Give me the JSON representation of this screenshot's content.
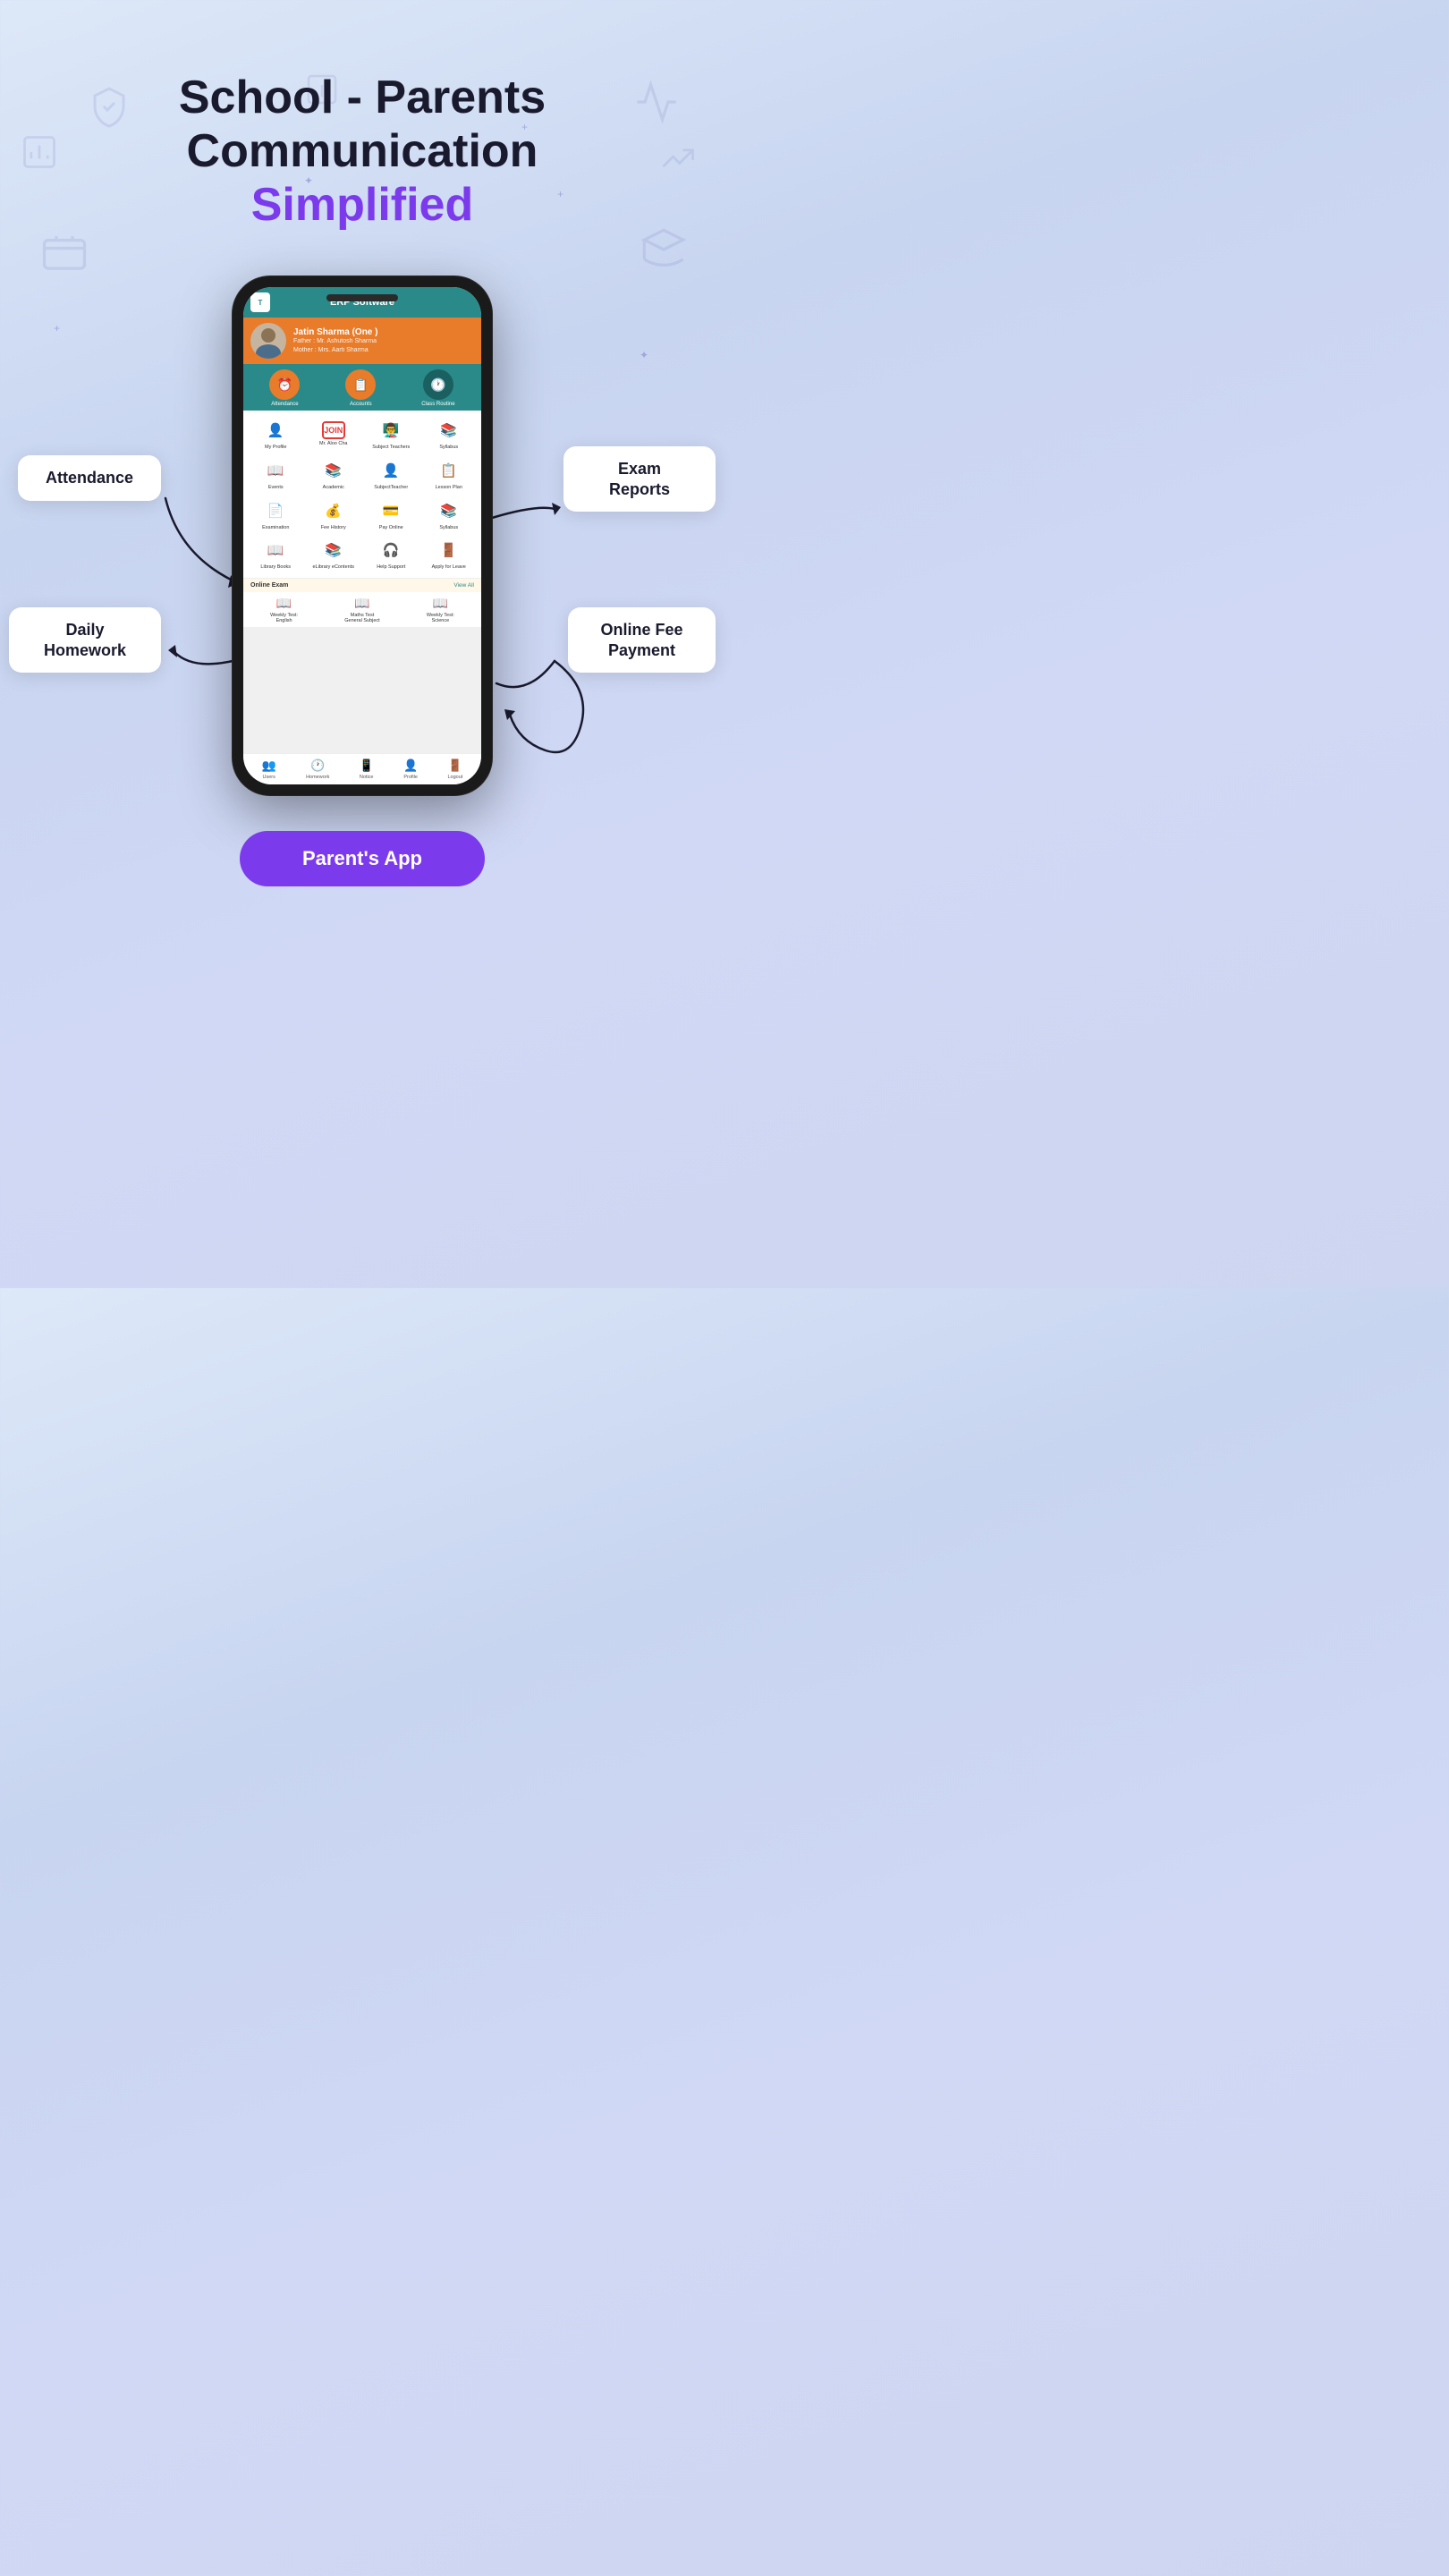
{
  "page": {
    "background": "linear-gradient(160deg, #dde8f8 0%, #c8d5f0 30%, #d0d8f5 60%, #cdd5f0 100%)"
  },
  "header": {
    "line1": "School - Parents",
    "line2": "Communication",
    "line3": "Simplified"
  },
  "app": {
    "title": "ERP Software",
    "logo_text": "T",
    "student": {
      "name": "Jatin Sharma (One )",
      "father": "Father : Mr. Ashutosh Sharma",
      "mother": "Mother : Mrs. Aarti Sharma"
    },
    "quick_nav": [
      {
        "label": "Attendance",
        "icon": "⏰"
      },
      {
        "label": "Accounts",
        "icon": "📋"
      },
      {
        "label": "Class Routine",
        "icon": "🕐"
      }
    ],
    "grid_items": [
      {
        "label": "My Profile",
        "icon": "👤",
        "color": "#e53935"
      },
      {
        "label": "Mr. Aloo Cha",
        "icon": "JOIN",
        "color": "#e53935"
      },
      {
        "label": "Subject Teachers",
        "icon": "👨‍🏫",
        "color": "#1565c0"
      },
      {
        "label": "Syllabus",
        "icon": "📚",
        "color": "#e87c2a"
      },
      {
        "label": "Events",
        "icon": "📖",
        "color": "#1565c0"
      },
      {
        "label": "Academic",
        "icon": "📚",
        "color": "#1565c0"
      },
      {
        "label": "SubjectTeacher",
        "icon": "👤",
        "color": "#1565c0"
      },
      {
        "label": "Lesson Plan",
        "icon": "📋",
        "color": "#1565c0"
      },
      {
        "label": "Examination",
        "icon": "📄",
        "color": "#1565c0"
      },
      {
        "label": "Fee History",
        "icon": "💰",
        "color": "#e87c2a"
      },
      {
        "label": "Pay Online",
        "icon": "💳",
        "color": "#1565c0"
      },
      {
        "label": "Syllabus",
        "icon": "📚",
        "color": "#e87c2a"
      },
      {
        "label": "Library Books",
        "icon": "📖",
        "color": "#1565c0"
      },
      {
        "label": "eLibrary eContents",
        "icon": "📚",
        "color": "#1565c0"
      },
      {
        "label": "Help Support",
        "icon": "🎧",
        "color": "#1565c0"
      },
      {
        "label": "Apply for Leave",
        "icon": "🚪",
        "color": "#1565c0"
      }
    ],
    "online_exam": {
      "title": "Online Exam",
      "view_all": "View All",
      "items": [
        {
          "label": "Weekly Test: English",
          "icon": "📖"
        },
        {
          "label": "Maths Test General Subject",
          "icon": "📖"
        },
        {
          "label": "Weekly Test: Science",
          "icon": "📖"
        }
      ]
    },
    "bottom_nav": [
      {
        "label": "Users",
        "icon": "👥"
      },
      {
        "label": "Homework",
        "icon": "🕐"
      },
      {
        "label": "Notice",
        "icon": "📱"
      },
      {
        "label": "Profile",
        "icon": "👤"
      },
      {
        "label": "Logout",
        "icon": "🚪"
      }
    ]
  },
  "labels": {
    "attendance": "Attendance",
    "daily_homework": "Daily\nHomework",
    "exam_reports": "Exam\nReports",
    "online_fee_payment": "Online Fee\nPayment"
  },
  "cta": {
    "label": "Parent's App"
  }
}
